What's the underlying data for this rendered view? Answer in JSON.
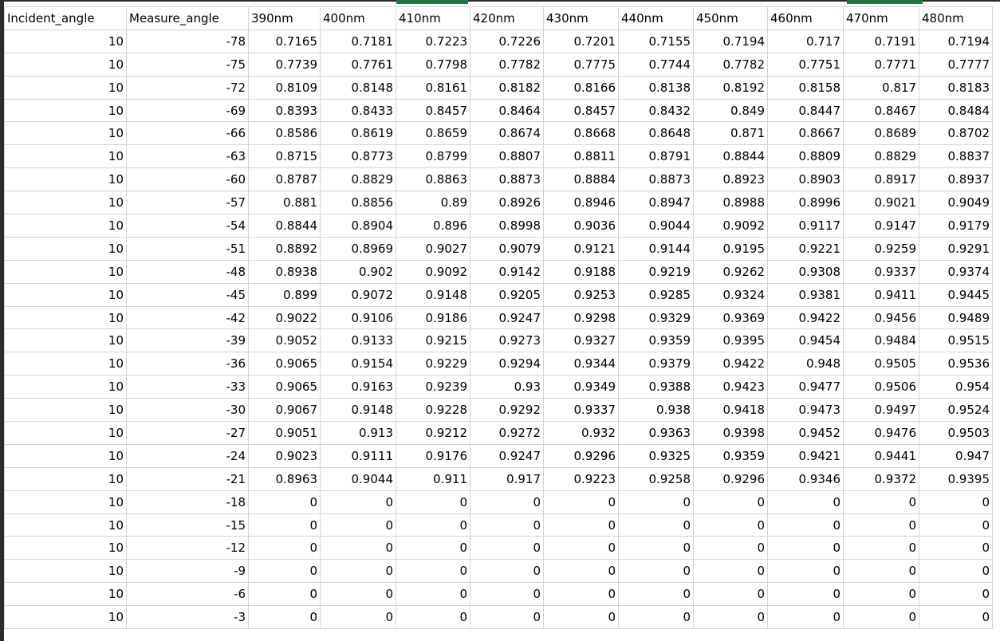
{
  "sheet": {
    "columns": [
      "Incident_angle",
      "Measure_angle",
      "390nm",
      "400nm",
      "410nm",
      "420nm",
      "430nm",
      "440nm",
      "450nm",
      "460nm",
      "470nm",
      "480nm"
    ],
    "rows": [
      [
        "10",
        "-78",
        "0.7165",
        "0.7181",
        "0.7223",
        "0.7226",
        "0.7201",
        "0.7155",
        "0.7194",
        "0.717",
        "0.7191",
        "0.7194"
      ],
      [
        "10",
        "-75",
        "0.7739",
        "0.7761",
        "0.7798",
        "0.7782",
        "0.7775",
        "0.7744",
        "0.7782",
        "0.7751",
        "0.7771",
        "0.7777"
      ],
      [
        "10",
        "-72",
        "0.8109",
        "0.8148",
        "0.8161",
        "0.8182",
        "0.8166",
        "0.8138",
        "0.8192",
        "0.8158",
        "0.817",
        "0.8183"
      ],
      [
        "10",
        "-69",
        "0.8393",
        "0.8433",
        "0.8457",
        "0.8464",
        "0.8457",
        "0.8432",
        "0.849",
        "0.8447",
        "0.8467",
        "0.8484"
      ],
      [
        "10",
        "-66",
        "0.8586",
        "0.8619",
        "0.8659",
        "0.8674",
        "0.8668",
        "0.8648",
        "0.871",
        "0.8667",
        "0.8689",
        "0.8702"
      ],
      [
        "10",
        "-63",
        "0.8715",
        "0.8773",
        "0.8799",
        "0.8807",
        "0.8811",
        "0.8791",
        "0.8844",
        "0.8809",
        "0.8829",
        "0.8837"
      ],
      [
        "10",
        "-60",
        "0.8787",
        "0.8829",
        "0.8863",
        "0.8873",
        "0.8884",
        "0.8873",
        "0.8923",
        "0.8903",
        "0.8917",
        "0.8937"
      ],
      [
        "10",
        "-57",
        "0.881",
        "0.8856",
        "0.89",
        "0.8926",
        "0.8946",
        "0.8947",
        "0.8988",
        "0.8996",
        "0.9021",
        "0.9049"
      ],
      [
        "10",
        "-54",
        "0.8844",
        "0.8904",
        "0.896",
        "0.8998",
        "0.9036",
        "0.9044",
        "0.9092",
        "0.9117",
        "0.9147",
        "0.9179"
      ],
      [
        "10",
        "-51",
        "0.8892",
        "0.8969",
        "0.9027",
        "0.9079",
        "0.9121",
        "0.9144",
        "0.9195",
        "0.9221",
        "0.9259",
        "0.9291"
      ],
      [
        "10",
        "-48",
        "0.8938",
        "0.902",
        "0.9092",
        "0.9142",
        "0.9188",
        "0.9219",
        "0.9262",
        "0.9308",
        "0.9337",
        "0.9374"
      ],
      [
        "10",
        "-45",
        "0.899",
        "0.9072",
        "0.9148",
        "0.9205",
        "0.9253",
        "0.9285",
        "0.9324",
        "0.9381",
        "0.9411",
        "0.9445"
      ],
      [
        "10",
        "-42",
        "0.9022",
        "0.9106",
        "0.9186",
        "0.9247",
        "0.9298",
        "0.9329",
        "0.9369",
        "0.9422",
        "0.9456",
        "0.9489"
      ],
      [
        "10",
        "-39",
        "0.9052",
        "0.9133",
        "0.9215",
        "0.9273",
        "0.9327",
        "0.9359",
        "0.9395",
        "0.9454",
        "0.9484",
        "0.9515"
      ],
      [
        "10",
        "-36",
        "0.9065",
        "0.9154",
        "0.9229",
        "0.9294",
        "0.9344",
        "0.9379",
        "0.9422",
        "0.948",
        "0.9505",
        "0.9536"
      ],
      [
        "10",
        "-33",
        "0.9065",
        "0.9163",
        "0.9239",
        "0.93",
        "0.9349",
        "0.9388",
        "0.9423",
        "0.9477",
        "0.9506",
        "0.954"
      ],
      [
        "10",
        "-30",
        "0.9067",
        "0.9148",
        "0.9228",
        "0.9292",
        "0.9337",
        "0.938",
        "0.9418",
        "0.9473",
        "0.9497",
        "0.9524"
      ],
      [
        "10",
        "-27",
        "0.9051",
        "0.913",
        "0.9212",
        "0.9272",
        "0.932",
        "0.9363",
        "0.9398",
        "0.9452",
        "0.9476",
        "0.9503"
      ],
      [
        "10",
        "-24",
        "0.9023",
        "0.9111",
        "0.9176",
        "0.9247",
        "0.9296",
        "0.9325",
        "0.9359",
        "0.9421",
        "0.9441",
        "0.947"
      ],
      [
        "10",
        "-21",
        "0.8963",
        "0.9044",
        "0.911",
        "0.917",
        "0.9223",
        "0.9258",
        "0.9296",
        "0.9346",
        "0.9372",
        "0.9395"
      ],
      [
        "10",
        "-18",
        "0",
        "0",
        "0",
        "0",
        "0",
        "0",
        "0",
        "0",
        "0",
        "0"
      ],
      [
        "10",
        "-15",
        "0",
        "0",
        "0",
        "0",
        "0",
        "0",
        "0",
        "0",
        "0",
        "0"
      ],
      [
        "10",
        "-12",
        "0",
        "0",
        "0",
        "0",
        "0",
        "0",
        "0",
        "0",
        "0",
        "0"
      ],
      [
        "10",
        "-9",
        "0",
        "0",
        "0",
        "0",
        "0",
        "0",
        "0",
        "0",
        "0",
        "0"
      ],
      [
        "10",
        "-6",
        "0",
        "0",
        "0",
        "0",
        "0",
        "0",
        "0",
        "0",
        "0",
        "0"
      ],
      [
        "10",
        "-3",
        "0",
        "0",
        "0",
        "0",
        "0",
        "0",
        "0",
        "0",
        "0",
        "0"
      ]
    ]
  },
  "colors": {
    "gridline": "#d4d4d4",
    "selected_column_marker": "#217346",
    "window_edge": "#2b2b2b"
  }
}
